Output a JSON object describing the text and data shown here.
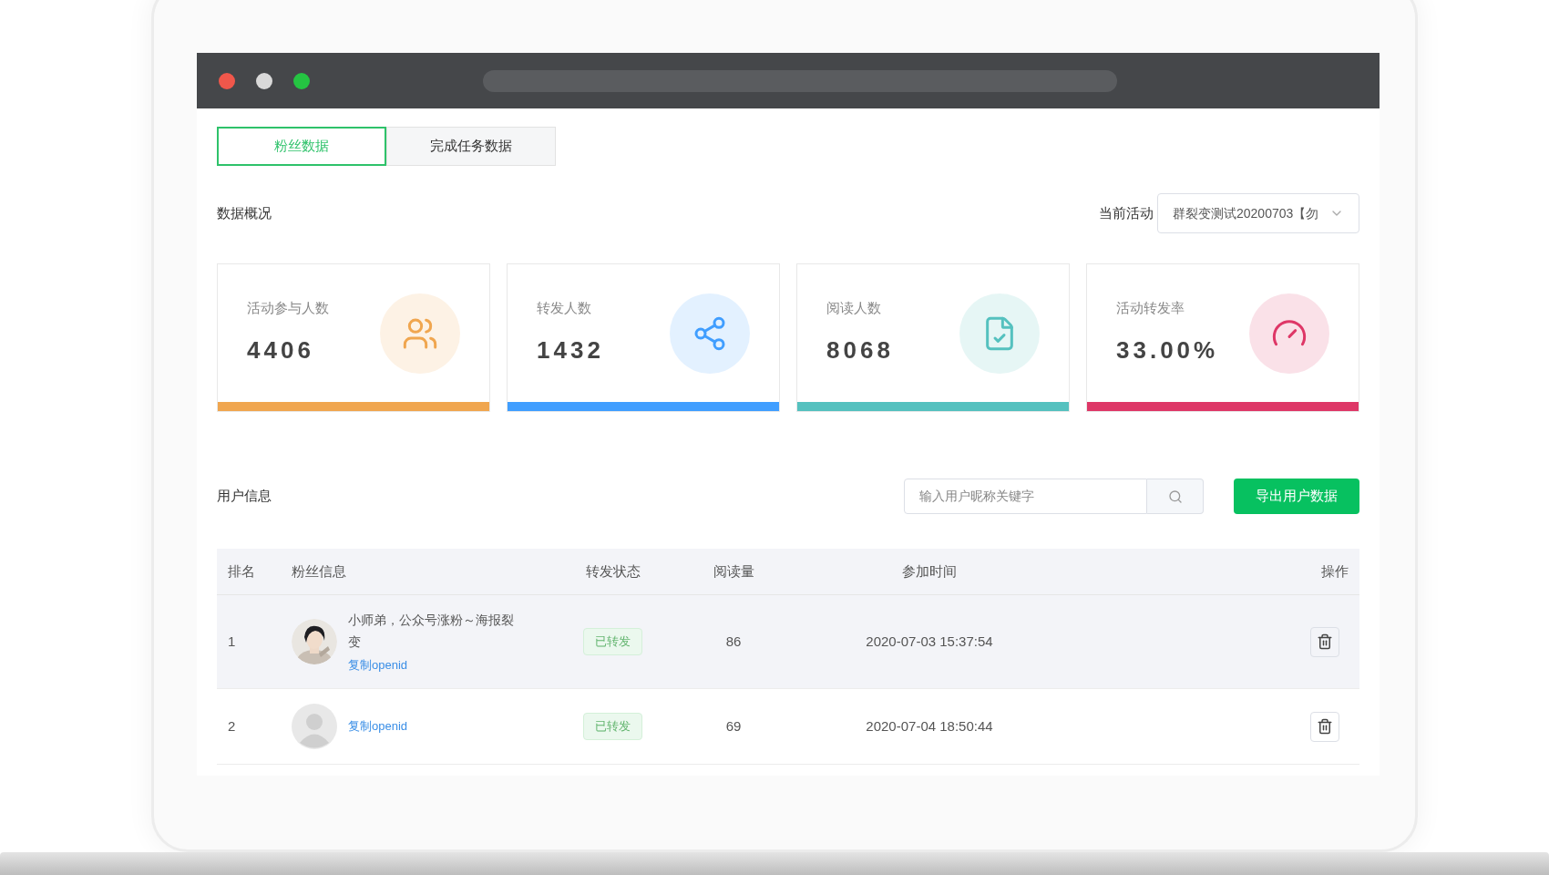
{
  "tabs": [
    {
      "label": "粉丝数据",
      "selected": true
    },
    {
      "label": "完成任务数据",
      "selected": false
    }
  ],
  "overview": {
    "title": "数据概况",
    "activity_label": "当前活动",
    "activity_value": "群裂变测试20200703【勿"
  },
  "stats": [
    {
      "kind": "people",
      "label": "活动参与人数",
      "value": "4406",
      "color": "#f0a64f"
    },
    {
      "kind": "share",
      "label": "转发人数",
      "value": "1432",
      "color": "#409eff"
    },
    {
      "kind": "read",
      "label": "阅读人数",
      "value": "8068",
      "color": "#55c1bf"
    },
    {
      "kind": "rate",
      "label": "活动转发率",
      "value": "33.00%",
      "color": "#de3767"
    }
  ],
  "users": {
    "title": "用户信息",
    "search": {
      "placeholder": "输入用户昵称关键字"
    },
    "export_button": "导出用户数据"
  },
  "table": {
    "columns": [
      "排名",
      "粉丝信息",
      "转发状态",
      "阅读量",
      "参加时间",
      "操作"
    ],
    "rows": [
      {
        "rank": "1",
        "kind": "picture",
        "nickname": "小师弟，公众号涨粉～海报裂变",
        "link": "复制openid",
        "status": "已转发",
        "reads": "86",
        "time": "2020-07-03 15:37:54",
        "selected": true
      },
      {
        "rank": "2",
        "kind": "default",
        "link": "复制openid",
        "status": "已转发",
        "reads": "69",
        "time": "2020-07-04 18:50:44",
        "selected": false
      }
    ]
  }
}
